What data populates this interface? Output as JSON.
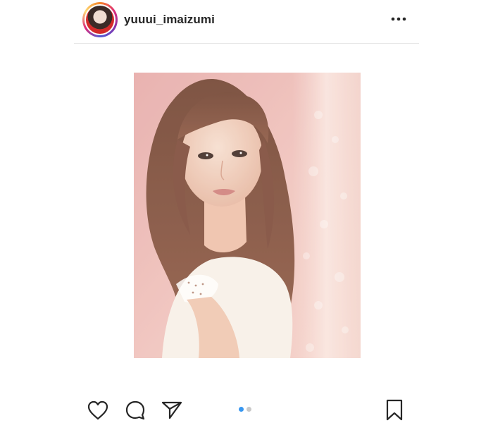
{
  "post": {
    "username": "yuuui_imaizumi",
    "avatar_icon": "profile-avatar",
    "more_icon": "more-options-icon"
  },
  "actions": {
    "like_icon": "heart-icon",
    "comment_icon": "comment-icon",
    "share_icon": "send-icon",
    "save_icon": "bookmark-icon"
  },
  "carousel": {
    "total": 2,
    "active_index": 0,
    "active_color": "#3897f0",
    "inactive_color": "#c9c9c9"
  }
}
